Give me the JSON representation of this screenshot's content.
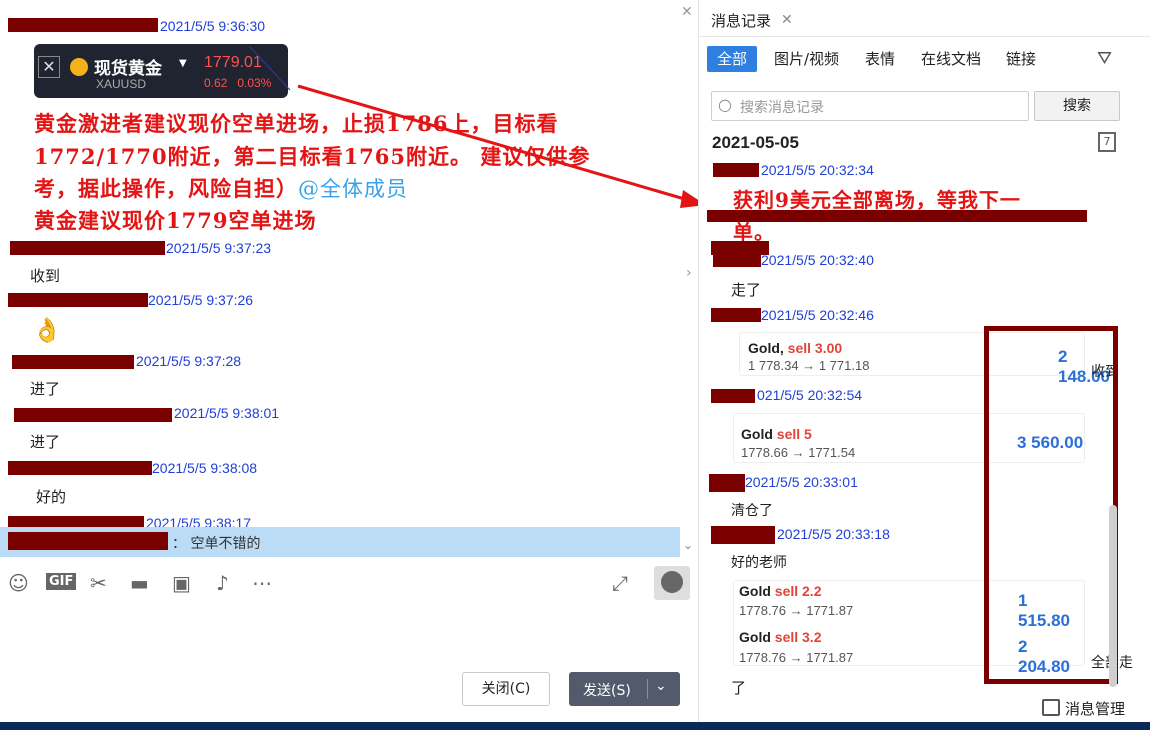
{
  "left": {
    "ticker": {
      "name": "现货黄金",
      "symbol": "XAUUSD",
      "price": "1779.01",
      "change": "0.62",
      "change_pct": "0.03%",
      "close_icon": "close-icon"
    },
    "first_ts": "2021/5/5 9:36:30",
    "red_text": {
      "line1": "黄金激进者建议现价空单进场，止损1786上，目标看",
      "line2": "1772/1770附近，第二目标看1765附近。  建议仅供参",
      "line3": "考，据此操作，风险自担）",
      "mention": "@全体成员",
      "line4": "黄金建议现价1779空单进场"
    },
    "messages": [
      {
        "ts": "2021/5/5 9:37:23",
        "text": "收到"
      },
      {
        "ts": "2021/5/5 9:37:26",
        "text": "👌"
      },
      {
        "ts": "2021/5/5 9:37:28",
        "text": "进了"
      },
      {
        "ts": "2021/5/5 9:38:01",
        "text": "进了"
      },
      {
        "ts": "2021/5/5 9:38:08",
        "text": "好的"
      },
      {
        "ts": "2021/5/5 9:38:17",
        "text": ""
      }
    ],
    "quote": "： 空单不错的",
    "buttons": {
      "close": "关闭(C)",
      "send": "发送(S)"
    }
  },
  "right": {
    "tab_title": "消息记录",
    "filters": [
      "全部",
      "图片/视频",
      "表情",
      "在线文档",
      "链接"
    ],
    "search_placeholder": "搜索消息记录",
    "search_button": "搜索",
    "date": "2021-05-05",
    "calendar_day": "7",
    "red_text": {
      "line1": "获利9美元全部离场，等我下一",
      "line2": "单。"
    },
    "msgs": [
      {
        "ts": "2021/5/5 20:32:34",
        "text": ""
      },
      {
        "ts": "2021/5/5 20:32:40",
        "text": "走了"
      },
      {
        "ts": "2021/5/5 20:32:46",
        "text": ""
      },
      {
        "ts": "021/5/5 20:32:54",
        "text": ""
      },
      {
        "ts": "2021/5/5 20:33:01",
        "text": "清仓了"
      },
      {
        "ts": "2021/5/5 20:33:18",
        "text": "好的老师"
      }
    ],
    "trades": [
      {
        "name": "Gold,",
        "sell": "sell 3.00",
        "route": "1 778.34 → 1 771.18",
        "profit": "2 148.00"
      },
      {
        "name": "Gold",
        "sell": "sell 5",
        "route": "1778.66 → 1771.54",
        "profit": "3 560.00"
      },
      {
        "name": "Gold",
        "sell": "sell 2.2",
        "route": "1778.76 → 1771.87",
        "profit": "1 515.80"
      },
      {
        "name": "Gold",
        "sell": "sell 3.2",
        "route": "1778.76 → 1771.87",
        "profit": "2 204.80"
      }
    ],
    "side_notes": {
      "a": "收到",
      "b": "全部走"
    },
    "last_text": "了",
    "manage": "消息管理"
  }
}
